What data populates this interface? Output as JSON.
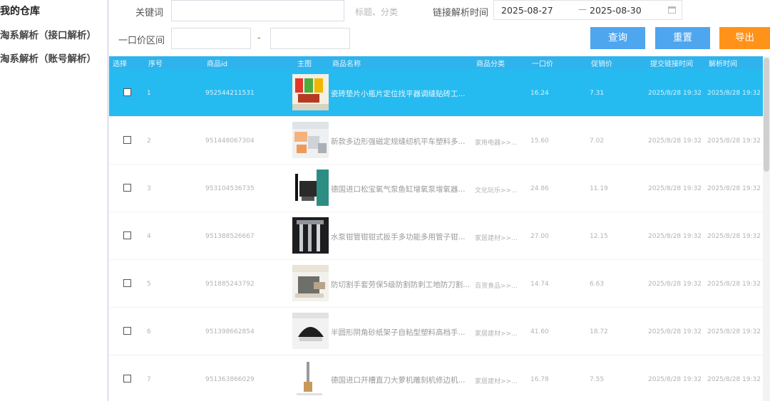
{
  "sidebar": {
    "title": "我的仓库",
    "items": [
      {
        "label": "淘系解析（接口解析）"
      },
      {
        "label": "淘系解析（账号解析）"
      }
    ]
  },
  "filters": {
    "keyword_label": "关键词",
    "keyword_hint": "标题、分类",
    "link_time_label": "链接解析时间",
    "date_start": "2025-08-27",
    "date_sep": "—",
    "date_end": "2025-08-30",
    "price_label": "一口价区间",
    "price_sep": "-"
  },
  "buttons": {
    "query": "查询",
    "reset": "重置",
    "export": "导出"
  },
  "colors": {
    "header_bg": "#2fb3ec",
    "selected_row": "#25bbf0",
    "button_blue": "#4ea6ef",
    "button_orange": "#ff9218"
  },
  "table": {
    "columns": [
      "选择",
      "序号",
      "商品id",
      "主图",
      "商品名称",
      "商品分类",
      "一口价",
      "促销价",
      "提交链接时间",
      "解析时间"
    ],
    "rows": [
      {
        "index": "1",
        "id": "952544211531",
        "name": "瓷砖垫片小瓶片定位找平器调缝贴砖工...",
        "category": "",
        "price": "16.24",
        "promo": "7.31",
        "submit_time": "2025/8/28 19:32",
        "parse_time": "2025/8/28 19:32",
        "selected": true
      },
      {
        "index": "2",
        "id": "951448067304",
        "name": "新款多边形强磁定规缝纫机平车塑料多...",
        "category": "家用电器>>...",
        "price": "15.60",
        "promo": "7.02",
        "submit_time": "2025/8/28 19:32",
        "parse_time": "2025/8/28 19:32",
        "selected": false
      },
      {
        "index": "3",
        "id": "953104536735",
        "name": "德国进口松宝氧气泵鱼缸增氧泵增氧器...",
        "category": "文化玩乐>>...",
        "price": "24.86",
        "promo": "11.19",
        "submit_time": "2025/8/28 19:32",
        "parse_time": "2025/8/28 19:32",
        "selected": false
      },
      {
        "index": "4",
        "id": "951388526667",
        "name": "水泵钳管钳钳式扳手多功能多用管子钳...",
        "category": "家居建材>>...",
        "price": "27.00",
        "promo": "12.15",
        "submit_time": "2025/8/28 19:32",
        "parse_time": "2025/8/28 19:32",
        "selected": false
      },
      {
        "index": "5",
        "id": "951885243792",
        "name": "防切割手套劳保5级防割防刺工地防刀割...",
        "category": "百货食品>>...",
        "price": "14.74",
        "promo": "6.63",
        "submit_time": "2025/8/28 19:32",
        "parse_time": "2025/8/28 19:32",
        "selected": false
      },
      {
        "index": "6",
        "id": "951398662854",
        "name": "半圆形阴角砂纸架子自粘型塑料高档手...",
        "category": "家居建材>>...",
        "price": "41.60",
        "promo": "18.72",
        "submit_time": "2025/8/28 19:32",
        "parse_time": "2025/8/28 19:32",
        "selected": false
      },
      {
        "index": "7",
        "id": "951363866029",
        "name": "德国进口开槽直刀大萝机雕刻机修边机...",
        "category": "家居建材>>...",
        "price": "16.78",
        "promo": "7.55",
        "submit_time": "2025/8/28 19:32",
        "parse_time": "2025/8/28 19:32",
        "selected": false
      }
    ]
  }
}
